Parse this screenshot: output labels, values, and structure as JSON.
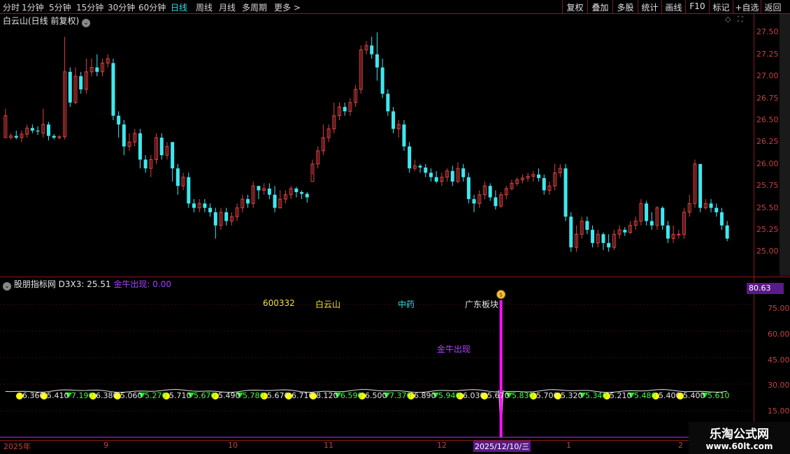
{
  "toolbar": {
    "periods": [
      "分时",
      "1分钟",
      "5分钟",
      "15分钟",
      "30分钟",
      "60分钟",
      "日线",
      "周线",
      "月线",
      "多周期",
      "更多"
    ],
    "active_period": "日线",
    "right_buttons": [
      "复权",
      "叠加",
      "多股",
      "统计",
      "画线",
      "F10",
      "标记",
      "+自选",
      "返回"
    ]
  },
  "chart_header": {
    "title": "白云山(日线 前复权)"
  },
  "indicator": {
    "name": "股朋指标网",
    "d3x3_label": "D3X3: 25.51",
    "golden_bull_label": "金牛出现: 0.00",
    "stock_code": "600332",
    "stock_name": "白云山",
    "sector": "中药",
    "board": "广东板块",
    "signal_text": "金牛出现",
    "current_value": "80.63",
    "axis_labels": [
      "75.00",
      "60.00",
      "45.00",
      "30.00",
      "15.00"
    ]
  },
  "price_axis": {
    "labels": [
      "27.50",
      "27.25",
      "27.00",
      "26.75",
      "26.50",
      "26.25",
      "26.00",
      "25.75",
      "25.50",
      "25.25",
      "25.00"
    ]
  },
  "date_axis": {
    "labels": [
      "2025年",
      "9",
      "10",
      "11",
      "12",
      "1",
      "2"
    ],
    "cursor_date": "2025/12/10/三"
  },
  "chart_data": {
    "type": "candlestick",
    "ylim": [
      24.94,
      27.55
    ],
    "candles": [
      [
        26.3,
        26.55,
        26.3,
        26.63
      ],
      [
        26.3,
        26.32,
        26.28,
        26.35
      ],
      [
        26.32,
        26.3,
        26.28,
        26.38
      ],
      [
        26.3,
        26.34,
        26.25,
        26.38
      ],
      [
        26.34,
        26.41,
        26.3,
        26.45
      ],
      [
        26.41,
        26.38,
        26.35,
        26.45
      ],
      [
        26.38,
        26.37,
        26.33,
        26.43
      ],
      [
        26.35,
        26.45,
        26.3,
        26.63
      ],
      [
        26.45,
        26.32,
        26.27,
        26.48
      ],
      [
        26.32,
        26.3,
        26.28,
        26.34
      ],
      [
        26.3,
        26.31,
        26.28,
        26.33
      ],
      [
        26.31,
        27.05,
        26.28,
        27.45
      ],
      [
        27.05,
        26.7,
        26.65,
        27.1
      ],
      [
        26.7,
        27.0,
        26.68,
        27.1
      ],
      [
        27.0,
        26.85,
        26.8,
        27.05
      ],
      [
        26.85,
        27.05,
        26.8,
        27.2
      ],
      [
        27.05,
        27.1,
        27.0,
        27.2
      ],
      [
        27.1,
        27.05,
        27.0,
        27.25
      ],
      [
        27.05,
        27.15,
        27.0,
        27.2
      ],
      [
        27.15,
        27.2,
        27.1,
        27.25
      ],
      [
        27.15,
        26.55,
        26.5,
        27.2
      ],
      [
        26.55,
        26.45,
        26.3,
        26.6
      ],
      [
        26.45,
        26.2,
        26.1,
        26.5
      ],
      [
        26.2,
        26.25,
        26.15,
        26.35
      ],
      [
        26.25,
        26.35,
        26.2,
        26.4
      ],
      [
        26.35,
        26.05,
        25.95,
        26.4
      ],
      [
        26.05,
        25.95,
        25.9,
        26.1
      ],
      [
        25.95,
        26.05,
        25.85,
        26.1
      ],
      [
        26.05,
        26.3,
        26.0,
        26.35
      ],
      [
        26.3,
        26.1,
        26.05,
        26.35
      ],
      [
        26.1,
        26.2,
        26.05,
        26.25
      ],
      [
        26.25,
        25.95,
        25.8,
        26.25
      ],
      [
        25.95,
        25.75,
        25.65,
        26.0
      ],
      [
        25.75,
        25.85,
        25.7,
        25.9
      ],
      [
        25.85,
        25.55,
        25.5,
        25.9
      ],
      [
        25.55,
        25.5,
        25.45,
        25.6
      ],
      [
        25.5,
        25.55,
        25.45,
        25.6
      ],
      [
        25.55,
        25.5,
        25.45,
        25.6
      ],
      [
        25.5,
        25.45,
        25.4,
        25.55
      ],
      [
        25.45,
        25.3,
        25.15,
        25.5
      ],
      [
        25.3,
        25.45,
        25.25,
        25.5
      ],
      [
        25.45,
        25.35,
        25.3,
        25.5
      ],
      [
        25.35,
        25.4,
        25.3,
        25.45
      ],
      [
        25.4,
        25.5,
        25.35,
        25.55
      ],
      [
        25.5,
        25.6,
        25.45,
        25.65
      ],
      [
        25.6,
        25.55,
        25.5,
        25.65
      ],
      [
        25.55,
        25.75,
        25.5,
        25.8
      ],
      [
        25.75,
        25.7,
        25.6,
        25.75
      ],
      [
        25.7,
        25.72,
        25.65,
        25.78
      ],
      [
        25.72,
        25.65,
        25.6,
        25.78
      ],
      [
        25.65,
        25.5,
        25.45,
        25.75
      ],
      [
        25.5,
        25.6,
        25.5,
        25.7
      ],
      [
        25.6,
        25.65,
        25.55,
        25.7
      ],
      [
        25.65,
        25.72,
        25.6,
        25.75
      ],
      [
        25.72,
        25.68,
        25.62,
        25.74
      ],
      [
        25.68,
        25.66,
        25.6,
        25.7
      ],
      [
        25.66,
        25.62,
        25.56,
        25.68
      ],
      [
        25.8,
        26.0,
        25.88,
        26.05
      ],
      [
        26.0,
        26.15,
        25.95,
        26.2
      ],
      [
        26.15,
        26.3,
        26.1,
        26.45
      ],
      [
        26.3,
        26.4,
        26.25,
        26.45
      ],
      [
        26.4,
        26.55,
        26.35,
        26.7
      ],
      [
        26.55,
        26.65,
        26.5,
        26.7
      ],
      [
        26.65,
        26.6,
        26.55,
        26.7
      ],
      [
        26.6,
        26.7,
        26.55,
        26.75
      ],
      [
        26.7,
        26.85,
        26.65,
        26.9
      ],
      [
        26.85,
        27.3,
        26.8,
        27.35
      ],
      [
        27.3,
        27.35,
        27.25,
        27.4
      ],
      [
        27.35,
        27.25,
        27.2,
        27.45
      ],
      [
        27.25,
        27.1,
        26.95,
        27.5
      ],
      [
        27.1,
        26.8,
        26.75,
        27.2
      ],
      [
        26.8,
        26.6,
        26.55,
        26.85
      ],
      [
        26.6,
        26.4,
        26.35,
        26.65
      ],
      [
        26.4,
        26.45,
        26.3,
        26.5
      ],
      [
        26.45,
        26.2,
        26.15,
        26.5
      ],
      [
        26.2,
        25.95,
        25.9,
        26.25
      ],
      [
        25.95,
        25.98,
        25.92,
        26.05
      ],
      [
        25.98,
        25.96,
        25.9,
        26.0
      ],
      [
        25.96,
        25.9,
        25.85,
        26.0
      ],
      [
        25.9,
        25.85,
        25.8,
        25.95
      ],
      [
        25.85,
        25.8,
        25.78,
        25.92
      ],
      [
        25.8,
        25.85,
        25.75,
        25.9
      ],
      [
        25.85,
        25.92,
        25.8,
        25.95
      ],
      [
        25.92,
        25.8,
        25.75,
        25.98
      ],
      [
        25.8,
        25.95,
        25.78,
        26.02
      ],
      [
        25.95,
        25.85,
        25.8,
        26.0
      ],
      [
        25.85,
        25.6,
        25.55,
        25.9
      ],
      [
        25.6,
        25.55,
        25.45,
        25.65
      ],
      [
        25.55,
        25.65,
        25.5,
        25.7
      ],
      [
        25.65,
        25.75,
        25.6,
        25.8
      ],
      [
        25.75,
        25.62,
        25.58,
        25.78
      ],
      [
        25.62,
        25.52,
        25.48,
        25.7
      ],
      [
        25.52,
        25.65,
        25.5,
        25.68
      ],
      [
        25.65,
        25.72,
        25.6,
        25.75
      ],
      [
        25.72,
        25.78,
        25.7,
        25.82
      ],
      [
        25.78,
        25.82,
        25.75,
        25.85
      ],
      [
        25.82,
        25.84,
        25.78,
        25.88
      ],
      [
        25.84,
        25.86,
        25.8,
        25.9
      ],
      [
        25.86,
        25.88,
        25.8,
        25.92
      ],
      [
        25.88,
        25.84,
        25.8,
        25.95
      ],
      [
        25.84,
        25.7,
        25.65,
        25.88
      ],
      [
        25.7,
        25.75,
        25.65,
        25.8
      ],
      [
        25.75,
        25.9,
        25.7,
        26.0
      ],
      [
        25.9,
        25.95,
        25.85,
        26.0
      ],
      [
        25.95,
        25.4,
        25.35,
        26.0
      ],
      [
        25.4,
        25.05,
        25.0,
        25.45
      ],
      [
        25.05,
        25.2,
        25.0,
        25.3
      ],
      [
        25.2,
        25.35,
        25.15,
        25.4
      ],
      [
        25.35,
        25.25,
        25.2,
        25.4
      ],
      [
        25.25,
        25.1,
        25.05,
        25.3
      ],
      [
        25.1,
        25.2,
        25.05,
        25.25
      ],
      [
        25.2,
        25.1,
        25.02,
        25.22
      ],
      [
        25.1,
        25.05,
        25.0,
        25.2
      ],
      [
        25.05,
        25.2,
        25.02,
        25.25
      ],
      [
        25.2,
        25.25,
        25.15,
        25.3
      ],
      [
        25.25,
        25.22,
        25.18,
        25.28
      ],
      [
        25.22,
        25.3,
        25.2,
        25.35
      ],
      [
        25.3,
        25.35,
        25.25,
        25.4
      ],
      [
        25.35,
        25.55,
        25.3,
        25.6
      ],
      [
        25.55,
        25.35,
        25.3,
        25.58
      ],
      [
        25.35,
        25.3,
        25.25,
        25.45
      ],
      [
        25.3,
        25.5,
        25.25,
        25.52
      ],
      [
        25.5,
        25.3,
        25.25,
        25.52
      ],
      [
        25.3,
        25.15,
        25.1,
        25.35
      ],
      [
        25.15,
        25.2,
        25.1,
        25.3
      ],
      [
        25.2,
        25.2,
        25.15,
        25.25
      ],
      [
        25.2,
        25.45,
        25.15,
        25.5
      ],
      [
        25.45,
        25.55,
        25.4,
        25.65
      ],
      [
        25.55,
        26.0,
        25.5,
        26.05
      ],
      [
        26.0,
        25.5,
        25.45,
        26.0
      ],
      [
        25.5,
        25.55,
        25.48,
        25.6
      ],
      [
        25.55,
        25.5,
        25.45,
        25.6
      ],
      [
        25.5,
        25.45,
        25.4,
        25.55
      ],
      [
        25.45,
        25.3,
        25.25,
        25.5
      ],
      [
        25.3,
        25.15,
        25.12,
        25.35
      ]
    ],
    "signal_markers": [
      [
        "ball",
        "6.360"
      ],
      [
        "ball",
        "5.410"
      ],
      [
        "tri",
        "7.190"
      ],
      [
        "ball",
        "6.380"
      ],
      [
        "ball",
        "5.060"
      ],
      [
        "tri",
        "5.270"
      ],
      [
        "ball",
        "5.710"
      ],
      [
        "tri",
        "5.670"
      ],
      [
        "ball",
        "5.490"
      ],
      [
        "tri",
        "5.780"
      ],
      [
        "ball",
        "5.670"
      ],
      [
        "ball",
        "6.710"
      ],
      [
        "ball",
        "8.120"
      ],
      [
        "tri",
        "6.590"
      ],
      [
        "ball",
        "6.500"
      ],
      [
        "tri",
        "7.370"
      ],
      [
        "ball",
        "6.890"
      ],
      [
        "tri",
        "5.940"
      ],
      [
        "ball",
        "6.030"
      ],
      [
        "ball",
        "5.670"
      ],
      [
        "tri",
        "5.830"
      ],
      [
        "ball",
        "5.700"
      ],
      [
        "ball",
        "5.320"
      ],
      [
        "tri",
        "5.340"
      ],
      [
        "ball",
        "5.210"
      ],
      [
        "tri",
        "5.480"
      ],
      [
        "ball",
        "5.400"
      ],
      [
        "ball",
        "5.400"
      ],
      [
        "tri",
        "5.610"
      ]
    ],
    "golden_bull_signal_index": 92,
    "indicator_ylim": [
      0,
      90
    ],
    "d3x3_level": 27
  },
  "watermark": {
    "brand": "乐淘公式网",
    "url": "www.60lt.com"
  },
  "colors": {
    "up": "#e04040",
    "down": "#3ee8f0",
    "signal": "#ff10ff",
    "ball": "#ffff00",
    "triangle": "#10ee10"
  }
}
